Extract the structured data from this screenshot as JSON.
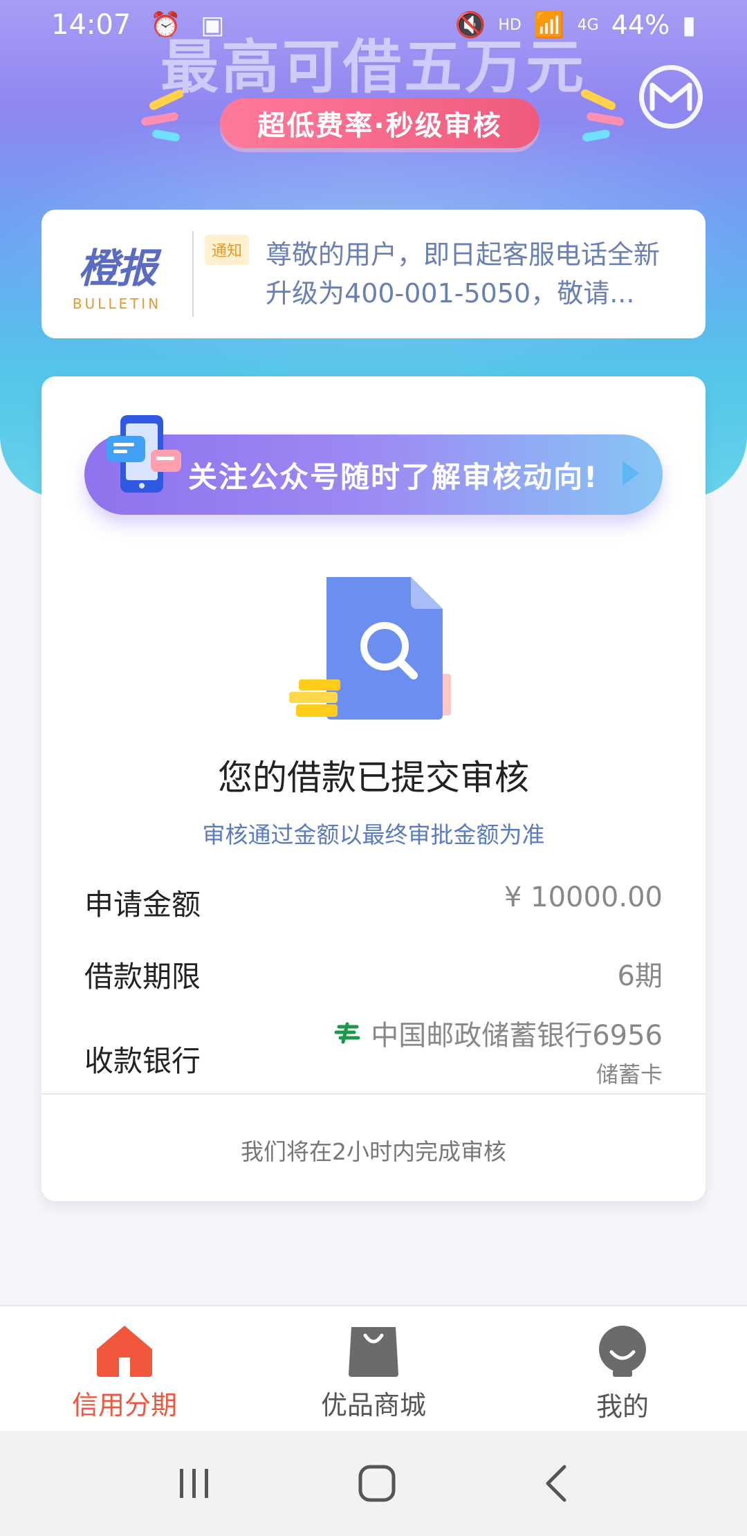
{
  "status_bar": {
    "time": "14:07",
    "alarm_icon": "alarm-icon",
    "image_icon": "image-icon",
    "network": "HD",
    "signal_label": "4G",
    "battery": "44%"
  },
  "hero": {
    "title": "最高可借五万元",
    "pill": "超低费率·秒级审核"
  },
  "bulletin": {
    "logo_cn": "橙报",
    "logo_en": "BULLETIN",
    "tag": "通知",
    "text": "尊敬的用户，即日起客服电话全新升级为400-001-5050，敬请..."
  },
  "promo": {
    "text": "关注公众号随时了解审核动向!"
  },
  "review": {
    "title": "您的借款已提交审核",
    "subtitle": "审核通过金额以最终审批金额为准",
    "rows": [
      {
        "label": "申请金额",
        "value": "¥ 10000.00"
      },
      {
        "label": "借款期限",
        "value": "6期"
      },
      {
        "label": "收款银行",
        "value": "中国邮政储蓄银行6956",
        "sub": "储蓄卡"
      }
    ],
    "footer": "我们将在2小时内完成审核"
  },
  "nav": {
    "items": [
      {
        "label": "信用分期",
        "icon": "home-icon",
        "active": true
      },
      {
        "label": "优品商城",
        "icon": "shopping-bag-icon",
        "active": false
      },
      {
        "label": "我的",
        "icon": "profile-icon",
        "active": false
      }
    ]
  },
  "colors": {
    "accent": "#f0573c",
    "link_blue": "#5b7bbf"
  }
}
